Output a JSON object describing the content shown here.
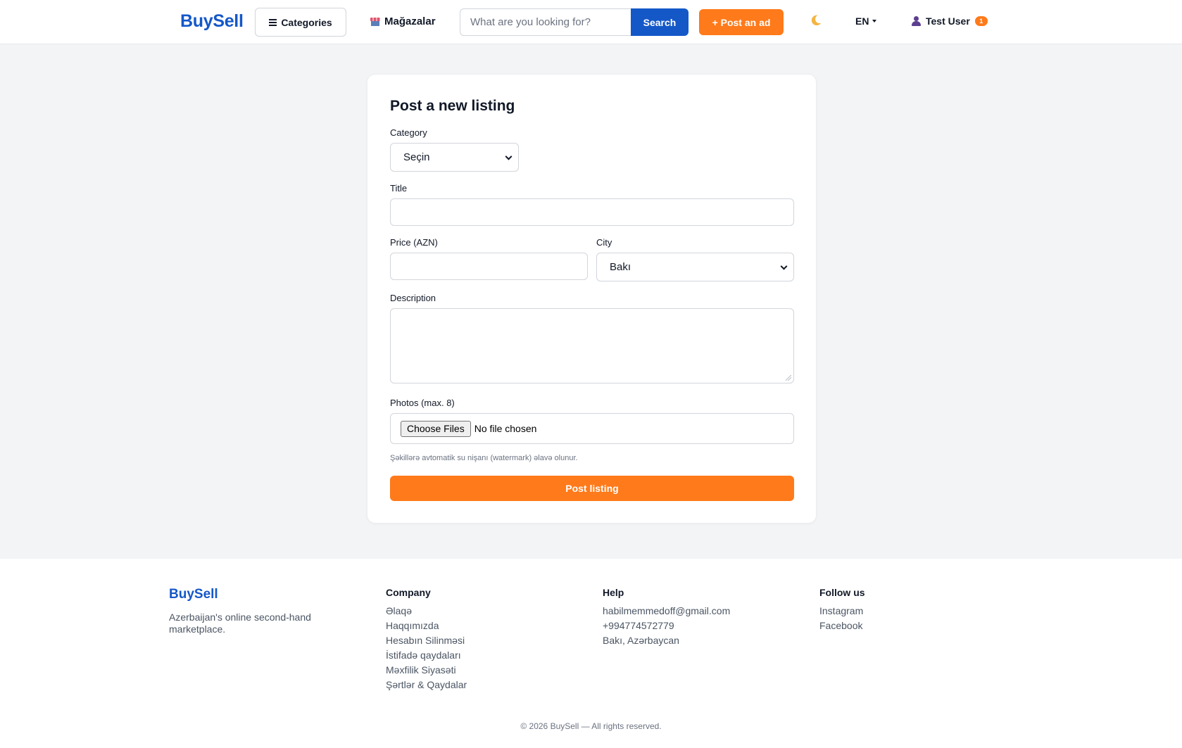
{
  "header": {
    "logo": "BuySell",
    "categories_label": "Categories",
    "shops_label": "Mağazalar",
    "search_placeholder": "What are you looking for?",
    "search_button": "Search",
    "post_ad_label": "+ Post an ad",
    "language": "EN",
    "user_name": "Test User",
    "notification_count": "1"
  },
  "form": {
    "title": "Post a new listing",
    "category_label": "Category",
    "category_value": "Seçin",
    "title_label": "Title",
    "price_label": "Price (AZN)",
    "city_label": "City",
    "city_value": "Bakı",
    "description_label": "Description",
    "photos_label": "Photos (max. 8)",
    "choose_files": "Choose Files",
    "no_file": "No file chosen",
    "watermark_note": "Şəkillərə avtomatik su nişanı (watermark) əlavə olunur.",
    "submit_label": "Post listing"
  },
  "footer": {
    "logo": "BuySell",
    "description": "Azerbaijan's online second-hand marketplace.",
    "company": {
      "heading": "Company",
      "links": [
        "Əlaqə",
        "Haqqımızda",
        "Hesabın Silinməsi",
        "İstifadə qaydaları",
        "Məxfilik Siyasəti",
        "Şərtlər & Qaydalar"
      ]
    },
    "help": {
      "heading": "Help",
      "items": [
        "habilmemmedoff@gmail.com",
        "+994774572779",
        "Bakı, Azərbaycan"
      ]
    },
    "follow": {
      "heading": "Follow us",
      "links": [
        "Instagram",
        "Facebook"
      ]
    },
    "copyright": "© 2026 BuySell — All rights reserved."
  },
  "colors": {
    "brand_blue": "#1458c8",
    "accent_orange": "#ff7a1a",
    "page_bg": "#f3f4f6"
  }
}
